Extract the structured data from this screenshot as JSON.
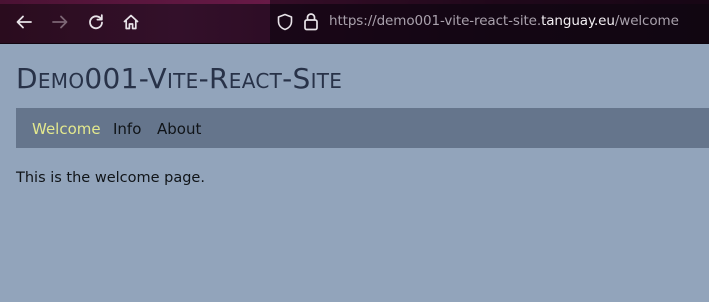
{
  "browser": {
    "url_prefix": "https://demo001-vite-react-site.",
    "url_host": "tanguay.eu",
    "url_path": "/welcome",
    "icons": {
      "back": "arrow-left-icon",
      "forward": "arrow-right-icon",
      "reload": "reload-icon",
      "home": "home-icon",
      "tracking_protection": "shield-icon",
      "security": "lock-icon"
    }
  },
  "site": {
    "title": "Demo001-Vite-React-Site",
    "nav": [
      {
        "label": "Welcome",
        "active": true
      },
      {
        "label": "Info",
        "active": false
      },
      {
        "label": "About",
        "active": false
      }
    ],
    "content": "This is the welcome page."
  },
  "colors": {
    "page_background": "#92a4bb",
    "nav_background": "#65758c",
    "nav_active": "#e3e88e",
    "title": "#283248",
    "text": "#101418"
  }
}
